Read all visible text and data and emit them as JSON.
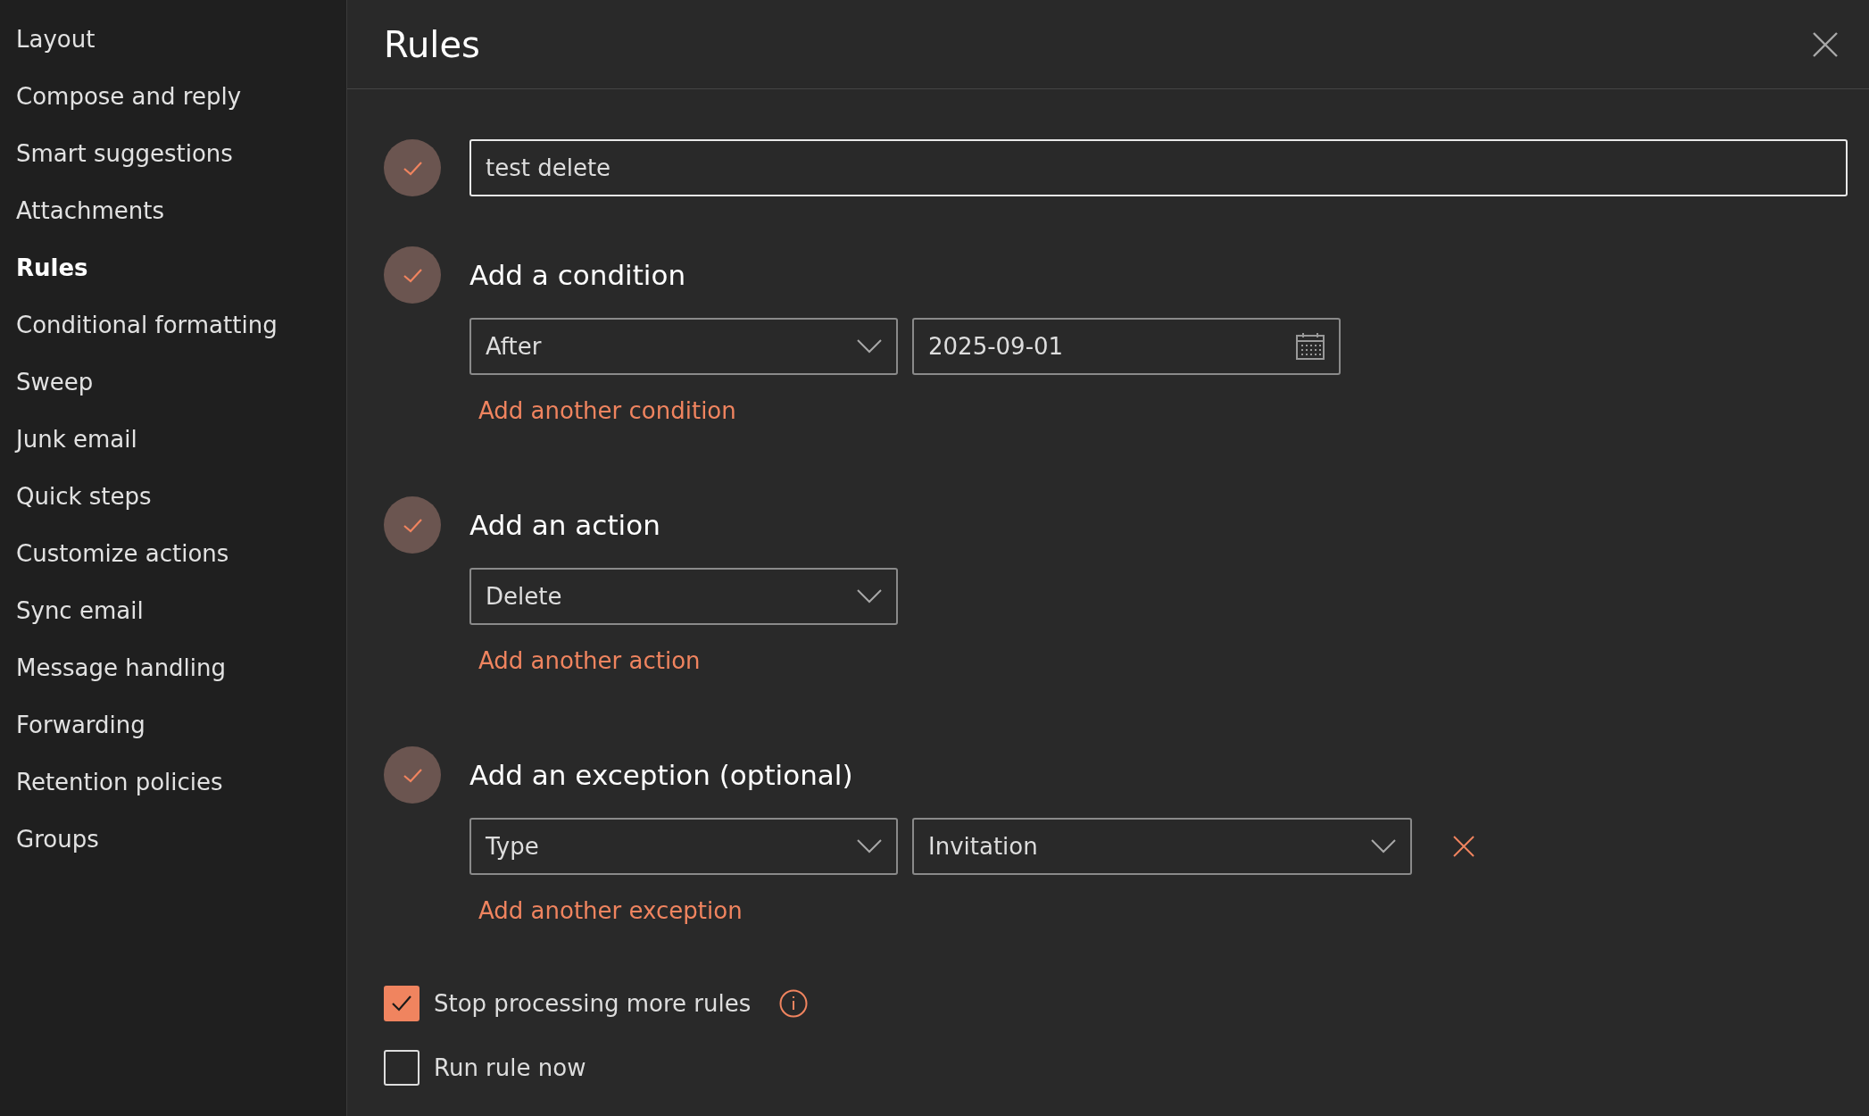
{
  "sidebar": {
    "items": [
      {
        "label": "Layout",
        "selected": false
      },
      {
        "label": "Compose and reply",
        "selected": false
      },
      {
        "label": "Smart suggestions",
        "selected": false
      },
      {
        "label": "Attachments",
        "selected": false
      },
      {
        "label": "Rules",
        "selected": true
      },
      {
        "label": "Conditional formatting",
        "selected": false
      },
      {
        "label": "Sweep",
        "selected": false
      },
      {
        "label": "Junk email",
        "selected": false
      },
      {
        "label": "Quick steps",
        "selected": false
      },
      {
        "label": "Customize actions",
        "selected": false
      },
      {
        "label": "Sync email",
        "selected": false
      },
      {
        "label": "Message handling",
        "selected": false
      },
      {
        "label": "Forwarding",
        "selected": false
      },
      {
        "label": "Retention policies",
        "selected": false
      },
      {
        "label": "Groups",
        "selected": false
      }
    ]
  },
  "header": {
    "title": "Rules"
  },
  "rule_name": {
    "value": "test delete"
  },
  "sections": [
    {
      "heading": "Add a condition",
      "fields": [
        {
          "kind": "dropdown",
          "value": "After"
        },
        {
          "kind": "date",
          "value": "2025-09-01"
        }
      ],
      "removable": false,
      "link": "Add another condition"
    },
    {
      "heading": "Add an action",
      "fields": [
        {
          "kind": "dropdown",
          "value": "Delete"
        }
      ],
      "removable": false,
      "link": "Add another action"
    },
    {
      "heading": "Add an exception (optional)",
      "fields": [
        {
          "kind": "dropdown",
          "value": "Type"
        },
        {
          "kind": "dropdown-wide",
          "value": "Invitation"
        }
      ],
      "removable": true,
      "link": "Add another exception"
    }
  ],
  "options": [
    {
      "label": "Stop processing more rules",
      "checked": true,
      "info": true
    },
    {
      "label": "Run rule now",
      "checked": false,
      "info": false
    }
  ]
}
